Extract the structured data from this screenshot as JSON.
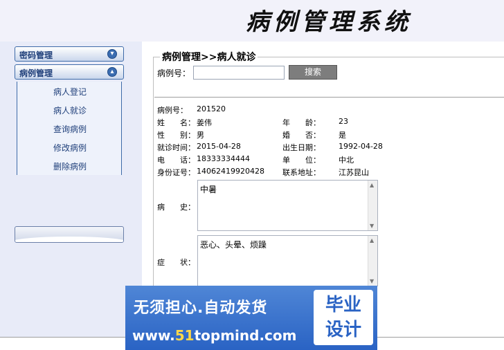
{
  "header": {
    "title": "病例管理系统"
  },
  "sidebar": {
    "menus": [
      {
        "label": "密码管理",
        "icon": "chevron-down-circle-icon"
      },
      {
        "label": "病例管理",
        "icon": "chevron-up-circle-icon"
      }
    ],
    "sub_items": [
      "病人登记",
      "病人就诊",
      "查询病例",
      "修改病例",
      "删除病例"
    ]
  },
  "main": {
    "legend": "病例管理>>病人就诊",
    "search": {
      "label": "病例号：",
      "value": "",
      "button": "搜索"
    },
    "record": {
      "case_no_label": "病例号：",
      "case_no": "201520",
      "name_label": "姓　　名：",
      "name": "姜伟",
      "age_label": "年　　龄：",
      "age": "23",
      "gender_label": "性　　别：",
      "gender": "男",
      "married_label": "婚　　否：",
      "married": "是",
      "visit_label": "就诊时间：",
      "visit": "2015-04-28",
      "birth_label": "出生日期：",
      "birth": "1992-04-28",
      "phone_label": "电　　话：",
      "phone": "18333334444",
      "unit_label": "单　　位：",
      "unit": "中北",
      "id_label": "身份证号：",
      "id": "14062419920428",
      "addr_label": "联系地址：",
      "addr": "江苏昆山",
      "history_label": "病　　史：",
      "history": "中暑",
      "symptom_label": "症　　状：",
      "symptom": "恶心、头晕、烦躁"
    }
  },
  "banner": {
    "line1": "无须担心.自动发货",
    "line2_prefix": "www.",
    "line2_num": "51",
    "line2_suffix": "topmind.com",
    "box_line1": "毕业",
    "box_line2": "设计"
  }
}
